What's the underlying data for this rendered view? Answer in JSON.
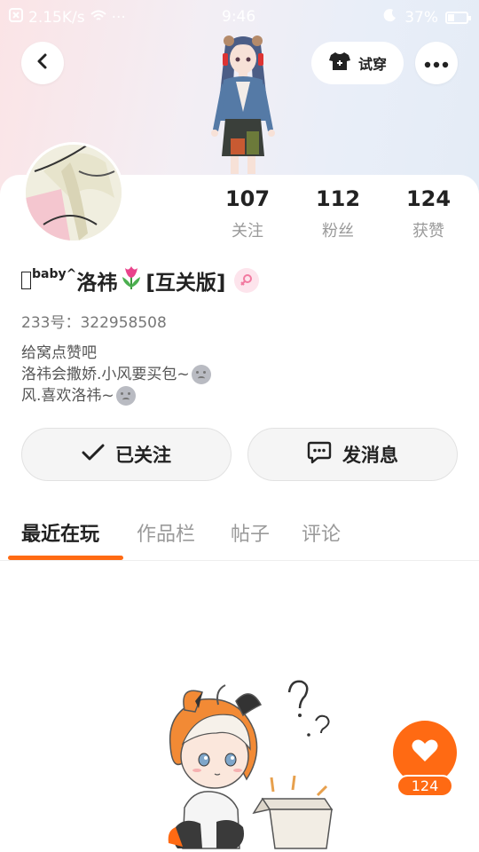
{
  "status_bar": {
    "net_speed": "2.15K/s",
    "time": "9:46",
    "battery": "37%",
    "battery_level": 0.37
  },
  "header": {
    "tryon_label": "试穿"
  },
  "stats": [
    {
      "value": "107",
      "label": "关注"
    },
    {
      "value": "112",
      "label": "粉丝"
    },
    {
      "value": "124",
      "label": "获赞"
    }
  ],
  "profile": {
    "name_prefix": "",
    "name_sup": "baby^",
    "name_main": "洛祎",
    "name_suffix": "[互关版]",
    "uid": "233号：322958508",
    "bio": [
      "给窝点赞吧",
      "洛祎会撒娇.小风要买包~",
      "风.喜欢洛祎~"
    ]
  },
  "actions": {
    "follow_label": "已关注",
    "message_label": "发消息"
  },
  "tabs": [
    "最近在玩",
    "作品栏",
    "帖子",
    "评论"
  ],
  "like": {
    "count": "124"
  },
  "colors": {
    "accent": "#ff6a13",
    "gender": "#f27aa0"
  }
}
